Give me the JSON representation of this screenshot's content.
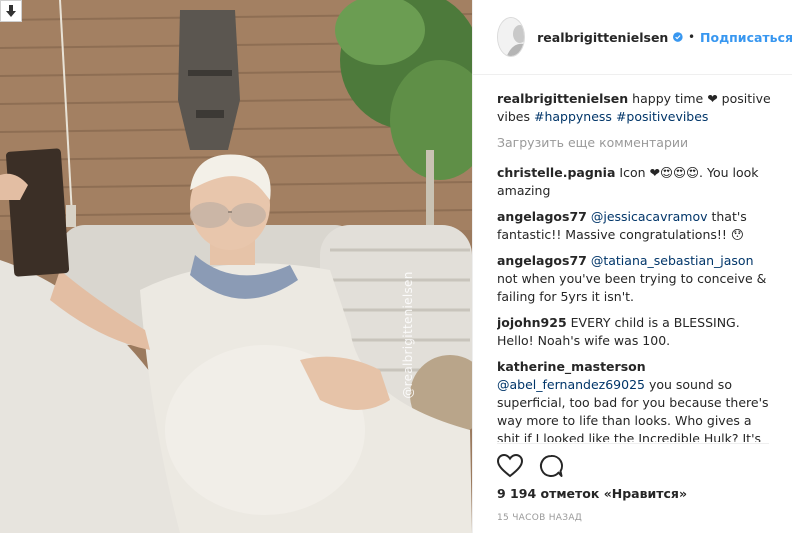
{
  "post": {
    "username": "realbrigittenielsen",
    "follow_label": "Подписаться",
    "dot": "•",
    "caption_text": "happy time ❤ positive vibes ",
    "caption_tags": [
      "#happyness",
      "#positivevibes"
    ],
    "load_more": "Загрузить еще комментарии",
    "watermark": "@realbrigittenielsen",
    "likes": "9 194 отметок «Нравится»",
    "time": "15 ЧАСОВ НАЗАД"
  },
  "comments": [
    {
      "user": "christelle.pagnia",
      "pre": "Icon ❤😍😍😍. You look amazing",
      "mention": "",
      "post": ""
    },
    {
      "user": "angelagos77",
      "pre": "",
      "mention": "@jessicacavramov",
      "post": " that's fantastic!! Massive congratulations!! 😯"
    },
    {
      "user": "angelagos77",
      "pre": "",
      "mention": "@tatiana_sebastian_jason",
      "post": " not when you've been trying to conceive & failing for 5yrs it isn't."
    },
    {
      "user": "jojohn925",
      "pre": "EVERY child is a BLESSING. Hello! Noah's wife was 100.",
      "mention": "",
      "post": ""
    },
    {
      "user": "katherine_masterson",
      "pre": "",
      "mention": "@abel_fernandez69025",
      "post": " you sound so superficial, too bad for you because there's way more to life than looks. Who gives a shit if I looked like the Incredible Hulk? It's got nothing to do with who I am. You're bound to die in this life alone."
    }
  ],
  "colors": {
    "accent": "#3897f0",
    "mention": "#003569",
    "muted": "#999999"
  },
  "icons": {
    "download": "download-icon",
    "verified": "verified-badge-icon",
    "like": "heart-icon",
    "comment": "comment-icon"
  }
}
